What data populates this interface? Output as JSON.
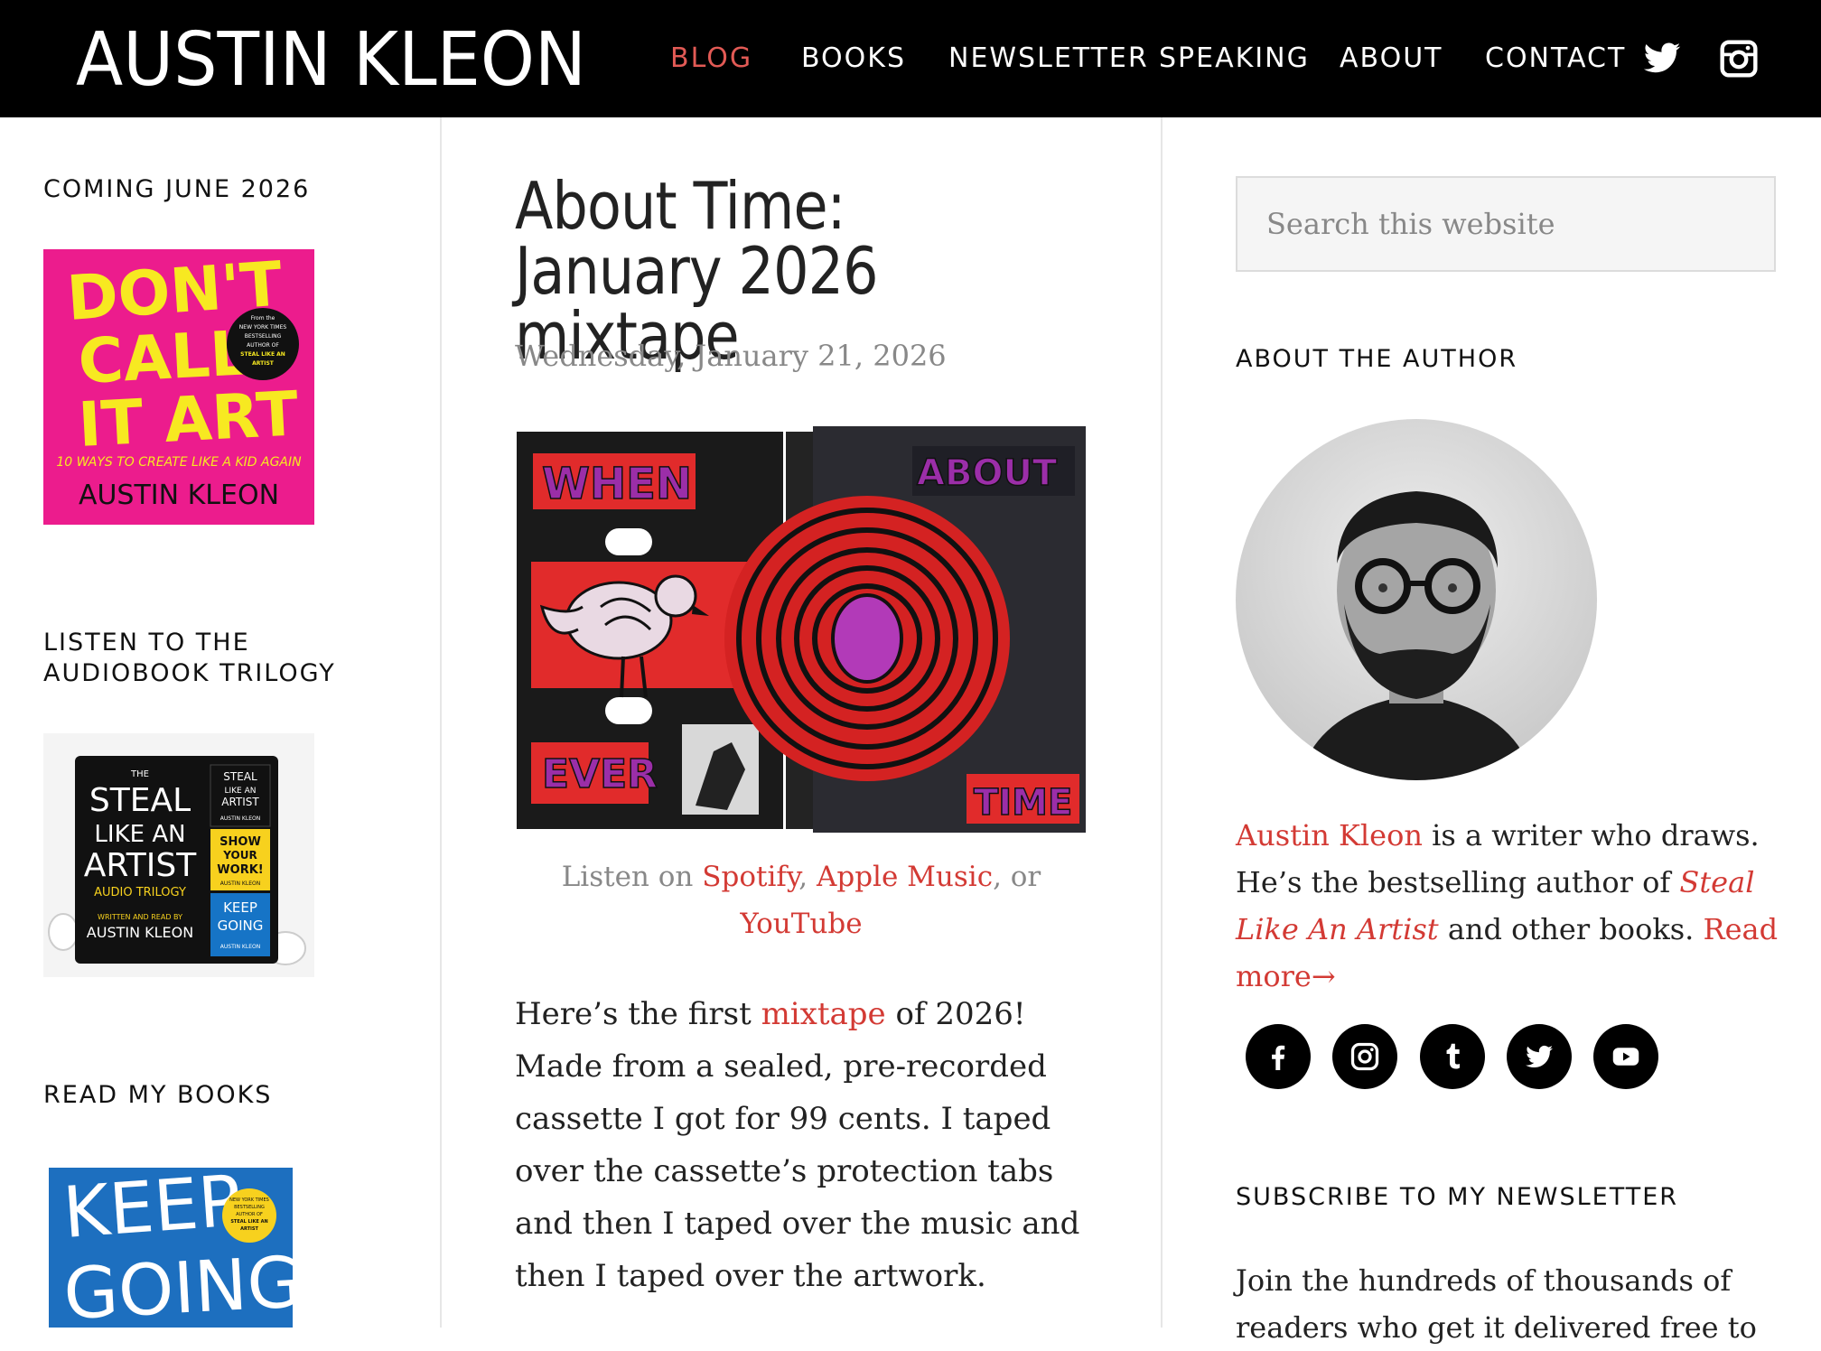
{
  "site": {
    "logo_text": "AUSTIN KLEON",
    "nav": [
      {
        "label": "BLOG",
        "active": true
      },
      {
        "label": "BOOKS"
      },
      {
        "label": "NEWSLETTER"
      },
      {
        "label": "SPEAKING"
      },
      {
        "label": "ABOUT"
      },
      {
        "label": "CONTACT"
      }
    ],
    "header_icons": [
      "twitter-icon",
      "instagram-icon"
    ],
    "colors": {
      "header_bg": "#000000",
      "accent": "#d33a34",
      "active_nav": "#e25a55"
    }
  },
  "left_sidebar": {
    "coming_title": "COMING JUNE 2026",
    "book1": {
      "title_lines": [
        "DON'T",
        "CALL",
        "IT ART"
      ],
      "badge": [
        "From the",
        "NEW YORK TIMES",
        "BESTSELLING",
        "AUTHOR OF",
        "STEAL LIKE AN",
        "ARTIST"
      ],
      "subtitle": "10 WAYS TO CREATE LIKE A KID AGAIN",
      "author": "AUSTIN KLEON"
    },
    "audiobook_title_line1": "LISTEN TO THE",
    "audiobook_title_line2": "AUDIOBOOK TRILOGY",
    "audiobook": {
      "the": "THE",
      "title_lines": [
        "STEAL",
        "LIKE AN",
        "ARTIST"
      ],
      "trilogy": "AUDIO TRILOGY",
      "read_by": "WRITTEN AND READ BY",
      "author": "AUSTIN KLEON",
      "mini1": [
        "STEAL",
        "LIKE AN",
        "ARTIST",
        "AUSTIN KLEON"
      ],
      "mini2": [
        "SHOW",
        "YOUR",
        "WORK!",
        "AUSTIN KLEON"
      ],
      "mini3": [
        "KEEP",
        "GOING",
        "AUSTIN KLEON"
      ]
    },
    "read_title": "READ MY BOOKS",
    "book3": {
      "title_lines": [
        "KEEP",
        "GOING"
      ],
      "badge": [
        "NEW YORK TIMES",
        "BESTSELLING",
        "AUTHOR OF",
        "STEAL LIKE AN",
        "ARTIST"
      ]
    }
  },
  "post": {
    "title": "About Time: January 2026 mixtape",
    "date": "Wednesday, January 21, 2026",
    "cassette_words": [
      "WHEN",
      "ABOUT",
      "EVER",
      "TIME"
    ],
    "listen_prefix": "Listen on",
    "spotify": "Spotify",
    "comma1": ",",
    "apple": "Apple Music",
    "or": ", or",
    "youtube": "YouTube",
    "body_1": "Here’s the first",
    "body_link": "mixtape",
    "body_2": "of 2026! Made from a sealed, pre-recorded cassette I got for 99 cents. I taped over the cassette’s protection tabs and then I taped over the music and then I taped over the artwork."
  },
  "right_sidebar": {
    "search_placeholder": "Search this website",
    "about_title": "ABOUT THE AUTHOR",
    "bio_name": "Austin Kleon",
    "bio_1": " is a writer who draws. He’s the bestselling author of ",
    "bio_book": "Steal Like An Artist",
    "bio_2": " and other books. ",
    "read_more": "Read more→",
    "social_icons": [
      "facebook-icon",
      "instagram-icon",
      "tumblr-icon",
      "twitter-icon",
      "youtube-icon"
    ],
    "newsletter_title": "SUBSCRIBE TO MY NEWSLETTER",
    "newsletter_text": "Join the hundreds of thousands of readers who get it delivered free to"
  }
}
